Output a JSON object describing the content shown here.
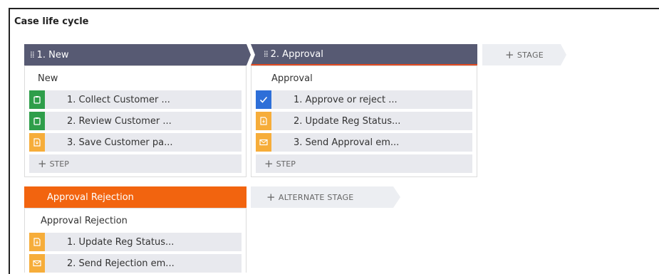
{
  "title": "Case life cycle",
  "colors": {
    "stage_header": "#575a73",
    "alternate_header": "#f2640f",
    "accent_line": "#e04b22",
    "step_green": "#2e9e4a",
    "step_blue": "#2e6fd8",
    "step_amber": "#f6ad3a"
  },
  "stages": [
    {
      "header": "1.  New",
      "panel_label": "New",
      "steps": [
        {
          "label": "1.  Collect Customer ...",
          "icon": "clipboard-icon",
          "color": "green"
        },
        {
          "label": "2.  Review Customer ...",
          "icon": "clipboard-icon",
          "color": "green"
        },
        {
          "label": "3.  Save Customer pa...",
          "icon": "save-icon",
          "color": "amber"
        }
      ],
      "add_step": "STEP"
    },
    {
      "header": "2.  Approval",
      "panel_label": "Approval",
      "steps": [
        {
          "label": "1.  Approve or reject ...",
          "icon": "checkmark-icon",
          "color": "blue"
        },
        {
          "label": "2.  Update Reg Status...",
          "icon": "save-icon",
          "color": "amber"
        },
        {
          "label": "3.  Send Approval em...",
          "icon": "email-icon",
          "color": "amber"
        }
      ],
      "add_step": "STEP"
    }
  ],
  "add_stage": "STAGE",
  "alternate_stages": [
    {
      "header": "Approval Rejection",
      "panel_label": "Approval Rejection",
      "steps": [
        {
          "label": "1.  Update Reg Status...",
          "icon": "save-icon",
          "color": "amber"
        },
        {
          "label": "2.  Send Rejection em...",
          "icon": "email-icon",
          "color": "amber"
        }
      ]
    }
  ],
  "add_alternate_stage": "ALTERNATE STAGE"
}
